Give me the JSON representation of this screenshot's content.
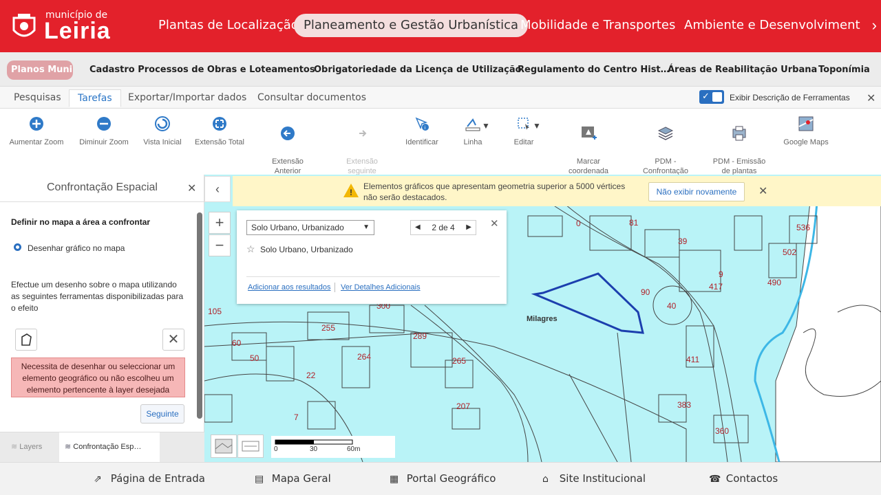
{
  "header": {
    "logo_small": "município de",
    "logo_big": "Leiria",
    "nav": [
      "Plantas de Localização",
      "Planeamento e Gestão Urbanística",
      "Mobilidade e Transportes",
      "Ambiente e Desenvolvimento Su"
    ],
    "active_nav": "Planeamento e Gestão Urbanística",
    "arrow": "›"
  },
  "subnav": [
    "Planos Muni…",
    "Cadastro Processos de Obras e Loteamentos",
    "Obrigatoriedade da Licença de Utilização",
    "Regulamento do Centro Hist…",
    "Áreas de Reabilitação Urbana",
    "Toponímia"
  ],
  "tabs": [
    "Pesquisas",
    "Tarefas",
    "Exportar/Importar dados",
    "Consultar documentos"
  ],
  "active_tab": "Tarefas",
  "toggle": {
    "label": "Exibir Descrição de Ferramentas",
    "checked": true
  },
  "toolbar": [
    {
      "label": "Aumentar Zoom",
      "icon": "zoom-in-icon"
    },
    {
      "label": "Diminuir Zoom",
      "icon": "zoom-out-icon"
    },
    {
      "label": "Vista Inicial",
      "icon": "home-view-icon"
    },
    {
      "label": "Extensão Total",
      "icon": "full-extent-icon"
    },
    {
      "label": "Extensão\nAnterior",
      "icon": "previous-extent-icon"
    },
    {
      "label": "Extensão\nseguinte",
      "icon": "next-extent-icon",
      "disabled": true
    },
    {
      "label": "Identificar",
      "icon": "identify-icon"
    },
    {
      "label": "Linha",
      "icon": "line-icon"
    },
    {
      "label": "Editar",
      "icon": "edit-icon"
    },
    {
      "label": "Marcar\ncoordenada",
      "icon": "mark-coordinate-icon"
    },
    {
      "label": "PDM -\nConfrontação",
      "icon": "layers-icon"
    },
    {
      "label": "PDM - Emissão\nde plantas",
      "icon": "print-plans-icon"
    },
    {
      "label": "Google Maps",
      "icon": "google-maps-icon"
    }
  ],
  "left_panel": {
    "title": "Confrontação Espacial",
    "heading": "Definir no mapa a área a confrontar",
    "radio_label": "Desenhar gráfico no mapa",
    "description": "Efectue um desenho sobre o mapa utilizando as seguintes ferramentas disponibilizadas para o efeito",
    "error": "Necessita de desenhar ou seleccionar um elemento geográfico ou não escolheu um elemento pertencente à layer desejada",
    "next_button": "Seguinte",
    "bottom_tabs": [
      "Layers",
      "Confrontação Esp…"
    ]
  },
  "banner": {
    "text1": "Elementos gráficos que apresentam geometria superior a 5000 vértices",
    "text2": "não serão destacados.",
    "button": "Não exibir novamente"
  },
  "popup": {
    "select_value": "Solo Urbano, Urbanizado",
    "pager": "2 de 4",
    "title": "Solo Urbano, Urbanizado",
    "link1": "Adicionar aos resultados",
    "link2": "Ver Detalhes Adicionais"
  },
  "map": {
    "place_label": "Milagres",
    "numbers": [
      "81",
      "0",
      "39",
      "536",
      "502",
      "9",
      "490",
      "417",
      "90",
      "40",
      "105",
      "300",
      "255",
      "289",
      "60",
      "50",
      "264",
      "265",
      "22",
      "411",
      "207",
      "383",
      "7",
      "360"
    ],
    "scale_labels": [
      "0",
      "30",
      "60m"
    ]
  },
  "footer": [
    "Página de Entrada",
    "Mapa Geral",
    "Portal Geográfico",
    "Site Institucional",
    "Contactos"
  ],
  "colors": {
    "brand_red": "#e3212b",
    "map_fill": "#b9f3f7",
    "selection": "#1c3fae",
    "river": "#3db7e6"
  }
}
